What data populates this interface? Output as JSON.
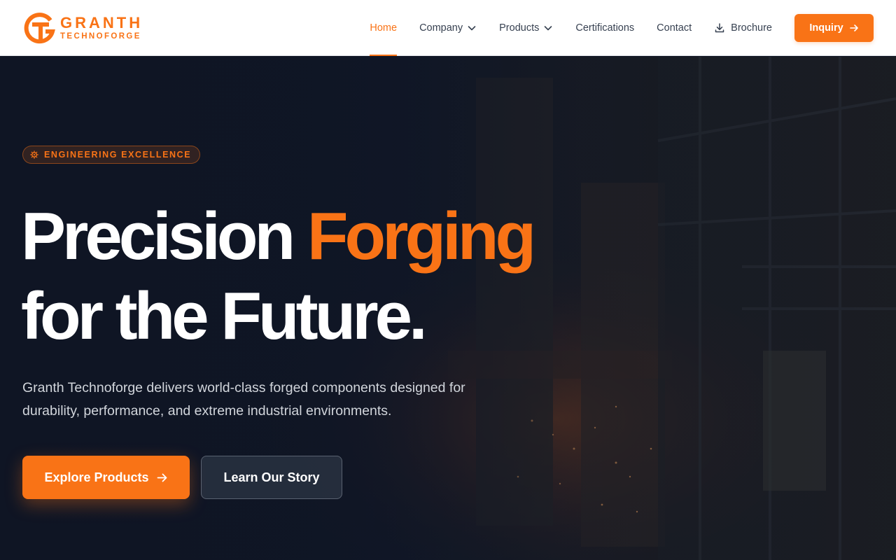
{
  "brand": {
    "name": "GRANTH",
    "subtitle": "TECHNOFORGE",
    "accent_color": "#f97316"
  },
  "nav": {
    "items": [
      {
        "label": "Home",
        "active": true
      },
      {
        "label": "Company",
        "has_dropdown": true
      },
      {
        "label": "Products",
        "has_dropdown": true
      },
      {
        "label": "Certifications"
      },
      {
        "label": "Contact"
      },
      {
        "label": "Brochure",
        "icon": "download-icon"
      }
    ],
    "cta_label": "Inquiry"
  },
  "hero": {
    "badge": "ENGINEERING EXCELLENCE",
    "headline_part1": "Precision ",
    "headline_accent": "Forging",
    "headline_line2": "for the Future.",
    "lead": "Granth Technoforge delivers world-class forged components designed for durability, performance, and extreme industrial environments.",
    "primary_button": "Explore Products",
    "secondary_button": "Learn Our Story"
  }
}
